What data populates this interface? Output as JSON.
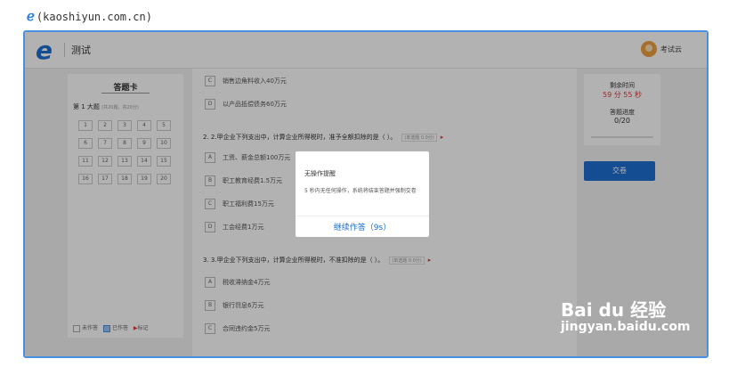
{
  "url_caption": "(kaoshiyun.com.cn)",
  "header": {
    "title": "测试",
    "user_name": "考试云"
  },
  "answer_card": {
    "title": "答题卡",
    "section_label": "第 1 大题",
    "section_meta": "(共20题，共20分)",
    "numbers": [
      "1",
      "2",
      "3",
      "4",
      "5",
      "6",
      "7",
      "8",
      "9",
      "10",
      "11",
      "12",
      "13",
      "14",
      "15",
      "16",
      "17",
      "18",
      "19",
      "20"
    ],
    "legend": {
      "not_done": "未作答",
      "done": "已作答",
      "flag": "标记"
    }
  },
  "questions": {
    "q1_options": [
      {
        "letter": "C",
        "text": "销售边角料收入40万元"
      },
      {
        "letter": "D",
        "text": "以产品抵偿债务60万元"
      }
    ],
    "q2": {
      "text": "2. 2.甲企业下列支出中，计算企业所得税时，准予全额扣除的是（    ）。",
      "tag": "(单选题 0.0分)",
      "options": [
        {
          "letter": "A",
          "text": "工资、薪金总额100万元"
        },
        {
          "letter": "B",
          "text": "职工教育经费1.5万元"
        },
        {
          "letter": "C",
          "text": "职工福利费15万元"
        },
        {
          "letter": "D",
          "text": "工会经费1万元"
        }
      ]
    },
    "q3": {
      "text": "3. 3.甲企业下列支出中，计算企业所得税时，不准扣除的是（    ）。",
      "tag": "(单选题 0.0分)",
      "options": [
        {
          "letter": "A",
          "text": "税收滞纳金4万元"
        },
        {
          "letter": "B",
          "text": "银行罚息6万元"
        },
        {
          "letter": "C",
          "text": "合同违约金5万元"
        }
      ]
    }
  },
  "sidebar_right": {
    "remaining_label": "剩余时间",
    "remaining_time": "59 分 55 秒",
    "progress_label": "答题进度",
    "progress_value": "0/20",
    "submit_label": "交卷"
  },
  "modal": {
    "title": "无操作提醒",
    "body": "5 秒内无任何操作，系统将结束答题并强制交卷",
    "button_label": "继续作答（9s）"
  },
  "watermark": {
    "brand": "Bai du 经验",
    "url": "jingyan.baidu.com"
  }
}
